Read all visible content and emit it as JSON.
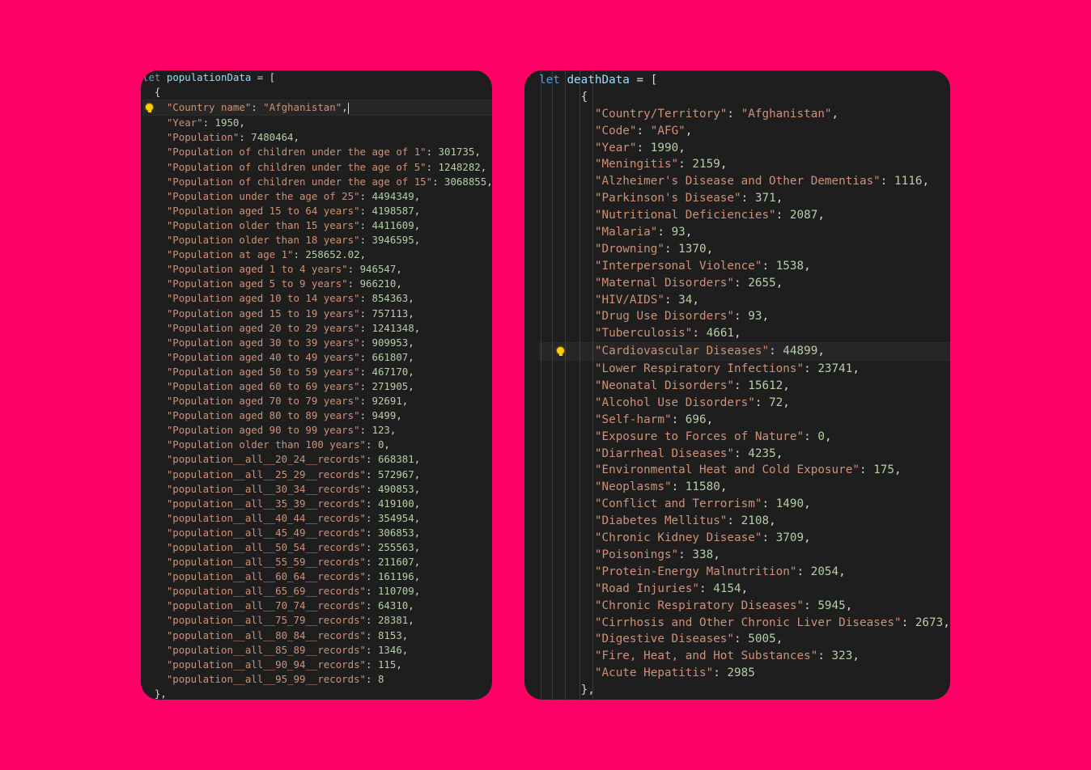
{
  "left": {
    "header": {
      "keyword": "let",
      "var": "populationData",
      "rest": " = ["
    },
    "open_brace": "{",
    "entries": [
      {
        "key": "\"Country name\"",
        "value": "\"Afghanistan\"",
        "type": "str",
        "suffix": ","
      },
      {
        "key": "\"Year\"",
        "value": "1950",
        "type": "num",
        "suffix": ","
      },
      {
        "key": "\"Population\"",
        "value": "7480464",
        "type": "num",
        "suffix": ","
      },
      {
        "key": "\"Population of children under the age of 1\"",
        "value": "301735",
        "type": "num",
        "suffix": ","
      },
      {
        "key": "\"Population of children under the age of 5\"",
        "value": "1248282",
        "type": "num",
        "suffix": ","
      },
      {
        "key": "\"Population of children under the age of 15\"",
        "value": "3068855",
        "type": "num",
        "suffix": ","
      },
      {
        "key": "\"Population under the age of 25\"",
        "value": "4494349",
        "type": "num",
        "suffix": ","
      },
      {
        "key": "\"Population aged 15 to 64 years\"",
        "value": "4198587",
        "type": "num",
        "suffix": ","
      },
      {
        "key": "\"Population older than 15 years\"",
        "value": "4411609",
        "type": "num",
        "suffix": ","
      },
      {
        "key": "\"Population older than 18 years\"",
        "value": "3946595",
        "type": "num",
        "suffix": ","
      },
      {
        "key": "\"Population at age 1\"",
        "value": "258652.02",
        "type": "num",
        "suffix": ","
      },
      {
        "key": "\"Population aged 1 to 4 years\"",
        "value": "946547",
        "type": "num",
        "suffix": ","
      },
      {
        "key": "\"Population aged 5 to 9 years\"",
        "value": "966210",
        "type": "num",
        "suffix": ","
      },
      {
        "key": "\"Population aged 10 to 14 years\"",
        "value": "854363",
        "type": "num",
        "suffix": ","
      },
      {
        "key": "\"Population aged 15 to 19 years\"",
        "value": "757113",
        "type": "num",
        "suffix": ","
      },
      {
        "key": "\"Population aged 20 to 29 years\"",
        "value": "1241348",
        "type": "num",
        "suffix": ","
      },
      {
        "key": "\"Population aged 30 to 39 years\"",
        "value": "909953",
        "type": "num",
        "suffix": ","
      },
      {
        "key": "\"Population aged 40 to 49 years\"",
        "value": "661807",
        "type": "num",
        "suffix": ","
      },
      {
        "key": "\"Population aged 50 to 59 years\"",
        "value": "467170",
        "type": "num",
        "suffix": ","
      },
      {
        "key": "\"Population aged 60 to 69 years\"",
        "value": "271905",
        "type": "num",
        "suffix": ","
      },
      {
        "key": "\"Population aged 70 to 79 years\"",
        "value": "92691",
        "type": "num",
        "suffix": ","
      },
      {
        "key": "\"Population aged 80 to 89 years\"",
        "value": "9499",
        "type": "num",
        "suffix": ","
      },
      {
        "key": "\"Population aged 90 to 99 years\"",
        "value": "123",
        "type": "num",
        "suffix": ","
      },
      {
        "key": "\"Population older than 100 years\"",
        "value": "0",
        "type": "num",
        "suffix": ","
      },
      {
        "key": "\"population__all__20_24__records\"",
        "value": "668381",
        "type": "num",
        "suffix": ","
      },
      {
        "key": "\"population__all__25_29__records\"",
        "value": "572967",
        "type": "num",
        "suffix": ","
      },
      {
        "key": "\"population__all__30_34__records\"",
        "value": "490853",
        "type": "num",
        "suffix": ","
      },
      {
        "key": "\"population__all__35_39__records\"",
        "value": "419100",
        "type": "num",
        "suffix": ","
      },
      {
        "key": "\"population__all__40_44__records\"",
        "value": "354954",
        "type": "num",
        "suffix": ","
      },
      {
        "key": "\"population__all__45_49__records\"",
        "value": "306853",
        "type": "num",
        "suffix": ","
      },
      {
        "key": "\"population__all__50_54__records\"",
        "value": "255563",
        "type": "num",
        "suffix": ","
      },
      {
        "key": "\"population__all__55_59__records\"",
        "value": "211607",
        "type": "num",
        "suffix": ","
      },
      {
        "key": "\"population__all__60_64__records\"",
        "value": "161196",
        "type": "num",
        "suffix": ","
      },
      {
        "key": "\"population__all__65_69__records\"",
        "value": "110709",
        "type": "num",
        "suffix": ","
      },
      {
        "key": "\"population__all__70_74__records\"",
        "value": "64310",
        "type": "num",
        "suffix": ","
      },
      {
        "key": "\"population__all__75_79__records\"",
        "value": "28381",
        "type": "num",
        "suffix": ","
      },
      {
        "key": "\"population__all__80_84__records\"",
        "value": "8153",
        "type": "num",
        "suffix": ","
      },
      {
        "key": "\"population__all__85_89__records\"",
        "value": "1346",
        "type": "num",
        "suffix": ","
      },
      {
        "key": "\"population__all__90_94__records\"",
        "value": "115",
        "type": "num",
        "suffix": ","
      },
      {
        "key": "\"population__all__95_99__records\"",
        "value": "8",
        "type": "num",
        "suffix": ""
      }
    ],
    "close_brace": "},",
    "lightbulb_icon": "lightbulb-icon"
  },
  "right": {
    "header": {
      "keyword": "let",
      "var": "deathData",
      "rest": " = ["
    },
    "open_brace": "{",
    "entries": [
      {
        "key": "\"Country/Territory\"",
        "value": "\"Afghanistan\"",
        "type": "str",
        "suffix": ","
      },
      {
        "key": "\"Code\"",
        "value": "\"AFG\"",
        "type": "str",
        "suffix": ","
      },
      {
        "key": "\"Year\"",
        "value": "1990",
        "type": "num",
        "suffix": ","
      },
      {
        "key": "\"Meningitis\"",
        "value": "2159",
        "type": "num",
        "suffix": ","
      },
      {
        "key": "\"Alzheimer's Disease and Other Dementias\"",
        "value": "1116",
        "type": "num",
        "suffix": ","
      },
      {
        "key": "\"Parkinson's Disease\"",
        "value": "371",
        "type": "num",
        "suffix": ","
      },
      {
        "key": "\"Nutritional Deficiencies\"",
        "value": "2087",
        "type": "num",
        "suffix": ","
      },
      {
        "key": "\"Malaria\"",
        "value": "93",
        "type": "num",
        "suffix": ","
      },
      {
        "key": "\"Drowning\"",
        "value": "1370",
        "type": "num",
        "suffix": ","
      },
      {
        "key": "\"Interpersonal Violence\"",
        "value": "1538",
        "type": "num",
        "suffix": ","
      },
      {
        "key": "\"Maternal Disorders\"",
        "value": "2655",
        "type": "num",
        "suffix": ","
      },
      {
        "key": "\"HIV/AIDS\"",
        "value": "34",
        "type": "num",
        "suffix": ","
      },
      {
        "key": "\"Drug Use Disorders\"",
        "value": "93",
        "type": "num",
        "suffix": ","
      },
      {
        "key": "\"Tuberculosis\"",
        "value": "4661",
        "type": "num",
        "suffix": ","
      },
      {
        "key": "\"Cardiovascular Diseases\"",
        "value": "44899",
        "type": "num",
        "suffix": ","
      },
      {
        "key": "\"Lower Respiratory Infections\"",
        "value": "23741",
        "type": "num",
        "suffix": ","
      },
      {
        "key": "\"Neonatal Disorders\"",
        "value": "15612",
        "type": "num",
        "suffix": ","
      },
      {
        "key": "\"Alcohol Use Disorders\"",
        "value": "72",
        "type": "num",
        "suffix": ","
      },
      {
        "key": "\"Self-harm\"",
        "value": "696",
        "type": "num",
        "suffix": ","
      },
      {
        "key": "\"Exposure to Forces of Nature\"",
        "value": "0",
        "type": "num",
        "suffix": ","
      },
      {
        "key": "\"Diarrheal Diseases\"",
        "value": "4235",
        "type": "num",
        "suffix": ","
      },
      {
        "key": "\"Environmental Heat and Cold Exposure\"",
        "value": "175",
        "type": "num",
        "suffix": ","
      },
      {
        "key": "\"Neoplasms\"",
        "value": "11580",
        "type": "num",
        "suffix": ","
      },
      {
        "key": "\"Conflict and Terrorism\"",
        "value": "1490",
        "type": "num",
        "suffix": ","
      },
      {
        "key": "\"Diabetes Mellitus\"",
        "value": "2108",
        "type": "num",
        "suffix": ","
      },
      {
        "key": "\"Chronic Kidney Disease\"",
        "value": "3709",
        "type": "num",
        "suffix": ","
      },
      {
        "key": "\"Poisonings\"",
        "value": "338",
        "type": "num",
        "suffix": ","
      },
      {
        "key": "\"Protein-Energy Malnutrition\"",
        "value": "2054",
        "type": "num",
        "suffix": ","
      },
      {
        "key": "\"Road Injuries\"",
        "value": "4154",
        "type": "num",
        "suffix": ","
      },
      {
        "key": "\"Chronic Respiratory Diseases\"",
        "value": "5945",
        "type": "num",
        "suffix": ","
      },
      {
        "key": "\"Cirrhosis and Other Chronic Liver Diseases\"",
        "value": "2673",
        "type": "num",
        "suffix": ","
      },
      {
        "key": "\"Digestive Diseases\"",
        "value": "5005",
        "type": "num",
        "suffix": ","
      },
      {
        "key": "\"Fire, Heat, and Hot Substances\"",
        "value": "323",
        "type": "num",
        "suffix": ","
      },
      {
        "key": "\"Acute Hepatitis\"",
        "value": "2985",
        "type": "num",
        "suffix": ""
      }
    ],
    "close_brace": "},",
    "lightbulb_icon": "lightbulb-icon"
  },
  "colors": {
    "background": "#ff0066",
    "editor": "#1e1e1e",
    "keyword": "#569cd6",
    "variable": "#9cdcfe",
    "string": "#ce9178",
    "number": "#b5cea8",
    "punctuation": "#d4d4d4",
    "lightbulb": "#ffcc00"
  }
}
